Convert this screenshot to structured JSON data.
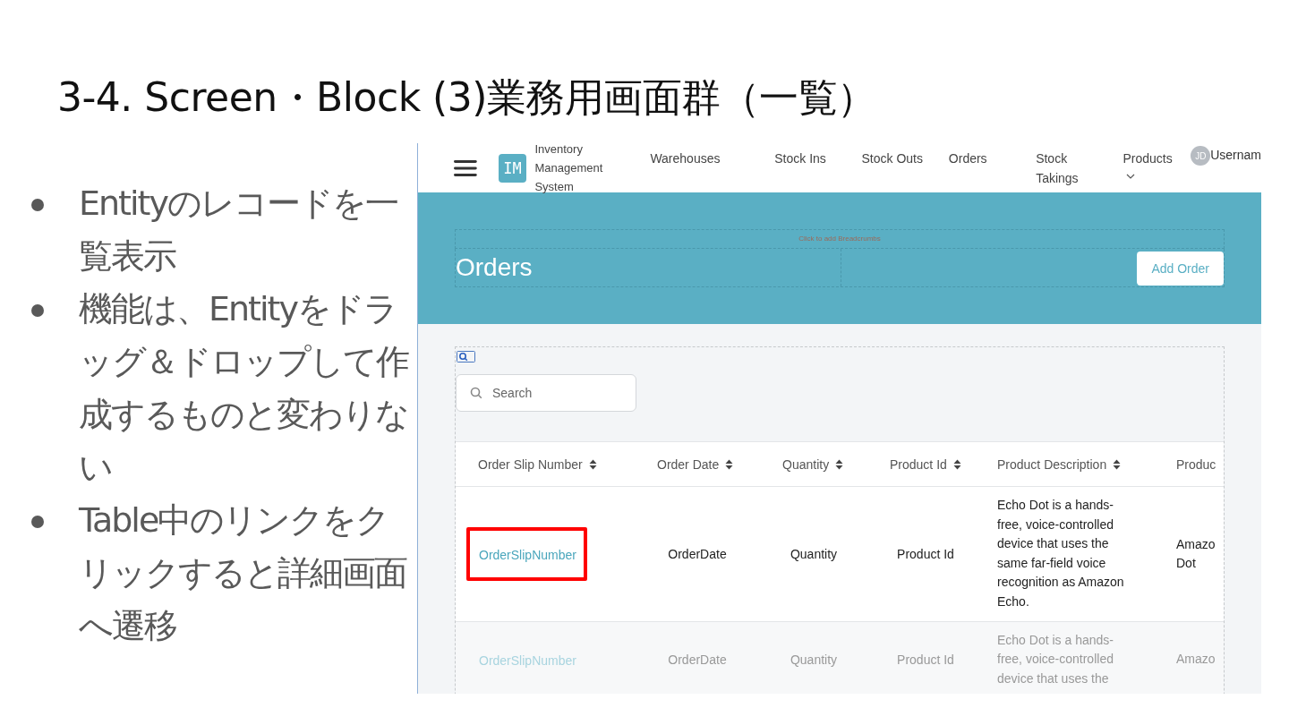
{
  "slide": {
    "title": "3-4. Screen・Block (3)業務用画面群（一覧）",
    "bullets": [
      "Entityのレコードを一覧表示",
      "機能は、Entityをドラッグ＆ドロップして作成するものと変わりない",
      "Table中のリンクをクリックすると詳細画面へ遷移"
    ]
  },
  "app": {
    "logo": "IM",
    "app_name": "Inventory Management System",
    "nav": [
      "Warehouses",
      "Stock Ins",
      "Stock Outs",
      "Orders",
      "Stock Takings",
      "Products"
    ],
    "avatar": "JD",
    "username": "Usernam",
    "breadcrumb_hint": "Click to add Breadcrumbs",
    "page_title": "Orders",
    "add_button": "Add Order",
    "search": {
      "placeholder": "Search"
    },
    "table": {
      "columns": [
        "Order Slip Number",
        "Order Date",
        "Quantity",
        "Product Id",
        "Product Description",
        "Produc"
      ],
      "rows": [
        {
          "faded": false,
          "highlighted": true,
          "cells": [
            "OrderSlipNumber",
            "OrderDate",
            "Quantity",
            "Product Id",
            "Echo Dot is a hands-free, voice-controlled device that uses the same far-field voice recognition as Amazon Echo.",
            "Amazo Dot"
          ]
        },
        {
          "faded": true,
          "highlighted": false,
          "cells": [
            "OrderSlipNumber",
            "OrderDate",
            "Quantity",
            "Product Id",
            "Echo Dot is a hands-free, voice-controlled device that uses the",
            "Amazo"
          ]
        }
      ]
    }
  }
}
